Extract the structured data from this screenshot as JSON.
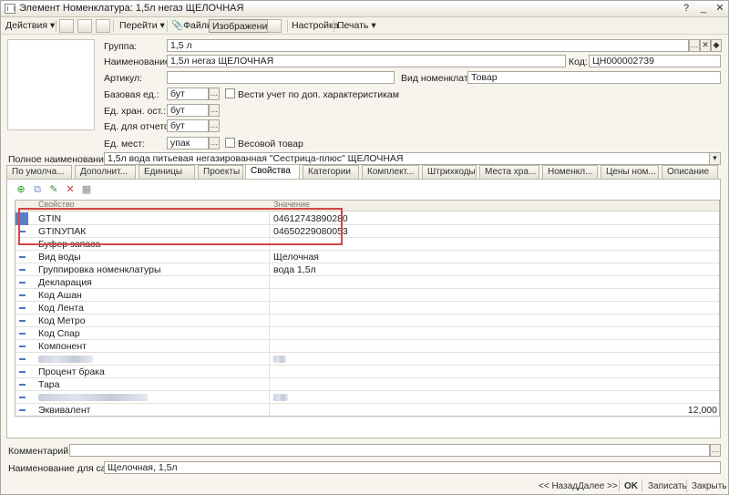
{
  "window": {
    "title": "Элемент Номенклатура: 1,5л негаз ЩЕЛОЧНАЯ"
  },
  "toolbar": {
    "actions": "Действия",
    "goto": "Перейти",
    "files": "Файлы",
    "image": "Изображение",
    "settings": "Настройка...",
    "print": "Печать"
  },
  "form": {
    "group_label": "Группа:",
    "group_value": "1,5 л",
    "name_label": "Наименование:",
    "name_value": "1,5л негаз ЩЕЛОЧНАЯ",
    "code_label": "Код:",
    "code_value": "ЦН000002739",
    "article_label": "Артикул:",
    "article_value": "",
    "kind_label": "Вид номенклатуры:",
    "kind_value": "Товар",
    "base_unit_label": "Базовая ед.:",
    "base_unit_value": "бут",
    "extra_chars_label": "Вести учет по доп. характеристикам",
    "storage_unit_label": "Ед. хран. ост.:",
    "storage_unit_value": "бут",
    "report_unit_label": "Ед. для отчетов:",
    "report_unit_value": "бут",
    "place_unit_label": "Ед. мест:",
    "place_unit_value": "упак",
    "weight_label": "Весовой товар",
    "full_name_label": "Полное наименование:",
    "full_name_value": "1,5л вода питьевая негазированная \"Сестрица-плюс\" ЩЕЛОЧНАЯ"
  },
  "tabs": [
    {
      "label": "По умолча..."
    },
    {
      "label": "Дополнит..."
    },
    {
      "label": "Единицы"
    },
    {
      "label": "Проекты"
    },
    {
      "label": "Свойства"
    },
    {
      "label": "Категории"
    },
    {
      "label": "Комплект..."
    },
    {
      "label": "Штрихкоды"
    },
    {
      "label": "Места хра..."
    },
    {
      "label": "Номенкл..."
    },
    {
      "label": "Цены ном..."
    },
    {
      "label": "Описание"
    }
  ],
  "grid": {
    "col_property": "Свойство",
    "col_value": "Значение",
    "rows": [
      {
        "prop": "GTIN",
        "value": "04612743890280"
      },
      {
        "prop": "GTINУПАК",
        "value": "04650229080053"
      },
      {
        "prop": "Буфер запаса",
        "value": ""
      },
      {
        "prop": "Вид воды",
        "value": "Щелочная"
      },
      {
        "prop": "Группировка номенклатуры",
        "value": "вода 1,5л"
      },
      {
        "prop": "Декларация",
        "value": ""
      },
      {
        "prop": "Код Ашан",
        "value": ""
      },
      {
        "prop": "Код Лента",
        "value": ""
      },
      {
        "prop": "Код Метро",
        "value": ""
      },
      {
        "prop": "Код Спар",
        "value": ""
      },
      {
        "prop": "Компонент",
        "value": ""
      },
      {
        "prop": "",
        "value": ""
      },
      {
        "prop": "Процент брака",
        "value": ""
      },
      {
        "prop": "Тара",
        "value": ""
      },
      {
        "prop": "",
        "value": ""
      },
      {
        "prop": "Эквивалент",
        "value": "12,000"
      }
    ]
  },
  "footer": {
    "comment_label": "Комментарий:",
    "comment_value": "",
    "site_name_label": "Наименование для сайта:",
    "site_name_value": "Щелочная, 1,5л",
    "back": "<< Назад",
    "next": "Далее >>",
    "ok": "OK",
    "save": "Записать",
    "close": "Закрыть"
  }
}
